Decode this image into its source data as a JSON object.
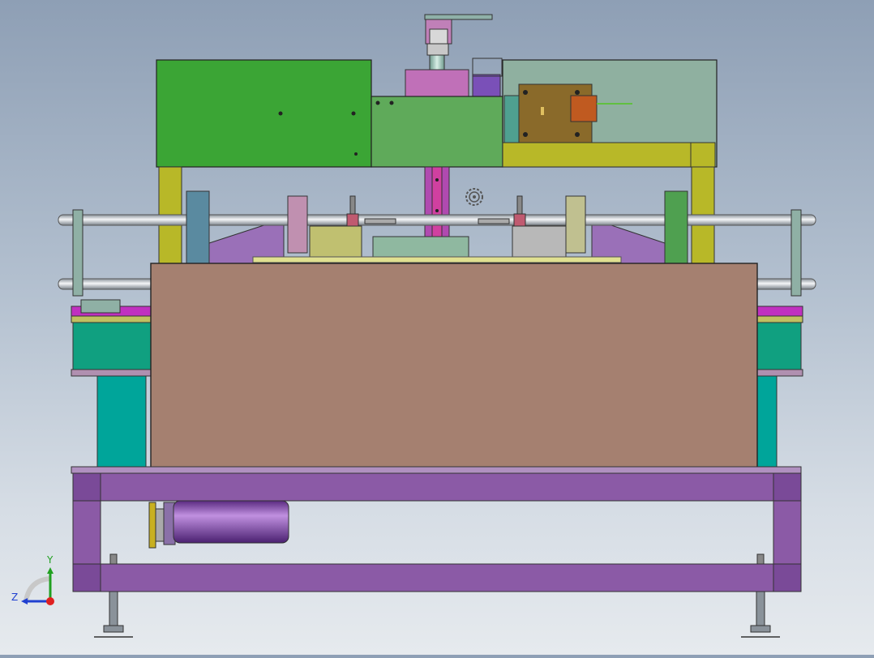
{
  "viewport": {
    "triad": {
      "y_label": "Y",
      "z_label": "Z",
      "x_color": "#e02020",
      "y_color": "#20a020",
      "z_color": "#2040d0"
    }
  },
  "colors": {
    "frame_purple": "#8b5aa6",
    "brown_cover": "#a58070",
    "green_box": "#3ba535",
    "teal_frame": "#00a59a",
    "yellow_column": "#b8b828",
    "grey_teal_box": "#8fb0a5",
    "motor_purple": "#7a3fa0"
  }
}
